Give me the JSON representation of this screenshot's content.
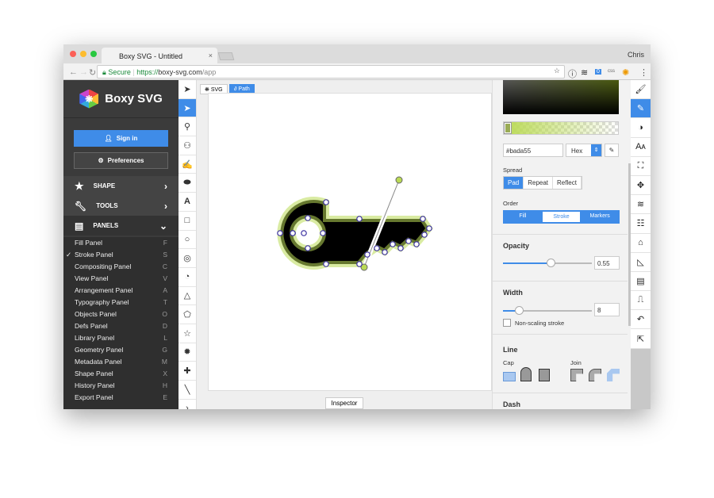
{
  "browser": {
    "tab_title": "Boxy SVG - Untitled",
    "user": "Chris",
    "secure_label": "Secure",
    "url_scheme": "https://",
    "url_host": "boxy-svg.com",
    "url_path": "/app",
    "ext_badge": "0",
    "ext_css": "css"
  },
  "sidebar": {
    "app_name": "Boxy SVG",
    "sign_in": "Sign in",
    "preferences": "Preferences",
    "sections": [
      {
        "label": "SHAPE",
        "icon": "star-icon"
      },
      {
        "label": "TOOLS",
        "icon": "wrench-icon"
      },
      {
        "label": "PANELS",
        "icon": "panel-icon"
      }
    ],
    "panels": [
      {
        "label": "Fill Panel",
        "key": "F"
      },
      {
        "label": "Stroke Panel",
        "key": "S",
        "checked": true
      },
      {
        "label": "Compositing Panel",
        "key": "C"
      },
      {
        "label": "View Panel",
        "key": "V"
      },
      {
        "label": "Arrangement Panel",
        "key": "A"
      },
      {
        "label": "Typography Panel",
        "key": "T"
      },
      {
        "label": "Objects Panel",
        "key": "O"
      },
      {
        "label": "Defs Panel",
        "key": "D"
      },
      {
        "label": "Library Panel",
        "key": "L"
      },
      {
        "label": "Geometry Panel",
        "key": "G"
      },
      {
        "label": "Metadata Panel",
        "key": "M"
      },
      {
        "label": "Shape Panel",
        "key": "X"
      },
      {
        "label": "History Panel",
        "key": "H"
      },
      {
        "label": "Export Panel",
        "key": "E"
      }
    ]
  },
  "canvas": {
    "tabs": [
      "SVG",
      "Path"
    ],
    "inspector": "Inspector",
    "stroke_color": "#bada55"
  },
  "stroke": {
    "hex_value": "#bada55",
    "format": "Hex",
    "spread_label": "Spread",
    "spread": [
      "Pad",
      "Repeat",
      "Reflect"
    ],
    "spread_selected": "Pad",
    "order_label": "Order",
    "order": [
      "Fill",
      "Stroke",
      "Markers"
    ],
    "order_selected": "Stroke",
    "opacity_label": "Opacity",
    "opacity": "0.55",
    "width_label": "Width",
    "width": "8",
    "width_fraction": 0.15,
    "non_scaling": "Non-scaling stroke",
    "line_label": "Line",
    "cap_label": "Cap",
    "join_label": "Join",
    "dash_label": "Dash"
  },
  "colors": {
    "accent": "#3f8ce8",
    "sidebar": "#3b3b3b"
  }
}
